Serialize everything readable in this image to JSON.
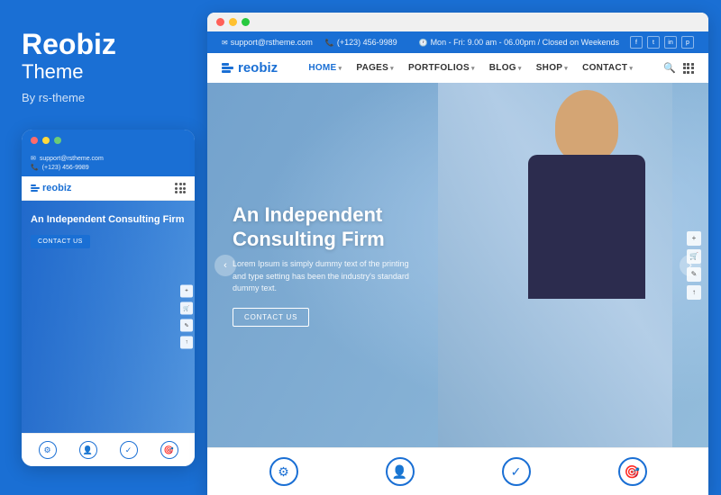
{
  "brand": {
    "name": "Reobiz",
    "subtitle": "Theme",
    "by": "By rs-theme"
  },
  "mobile": {
    "dots": [
      "red",
      "yellow",
      "green"
    ],
    "topbar_items": [
      {
        "icon": "✉",
        "text": "support@rstheme.com"
      },
      {
        "icon": "📞",
        "text": "(+123) 456-9989"
      }
    ],
    "logo_text": "reobiz",
    "hero_title": "An Independent Consulting Firm",
    "hero_btn": "CONTACT US",
    "bottom_icons": [
      "⚙",
      "👤",
      "✓",
      "🎯"
    ]
  },
  "desktop": {
    "topbar": {
      "email": "support@rstheme.com",
      "phone": "(+123) 456-9989",
      "hours": "Mon - Fri: 9.00 am - 06.00pm / Closed on Weekends",
      "socials": [
        "f",
        "t",
        "in",
        "p"
      ]
    },
    "nav": {
      "logo": "reobiz",
      "links": [
        {
          "label": "HOME",
          "active": true,
          "has_dropdown": true
        },
        {
          "label": "PAGES",
          "active": false,
          "has_dropdown": true
        },
        {
          "label": "PORTFOLIOS",
          "active": false,
          "has_dropdown": true
        },
        {
          "label": "BLOG",
          "active": false,
          "has_dropdown": true
        },
        {
          "label": "SHOP",
          "active": false,
          "has_dropdown": true
        },
        {
          "label": "CONTACT",
          "active": false,
          "has_dropdown": true
        }
      ]
    },
    "hero": {
      "title": "An Independent Consulting Firm",
      "subtitle": "Lorem Ipsum is simply dummy text of the printing and type setting has been the industry's standard dummy text.",
      "btn_label": "CONTACT US",
      "arrow_left": "‹",
      "arrow_right": "›"
    },
    "bottom_icons": [
      {
        "icon": "⚙"
      },
      {
        "icon": "👤"
      },
      {
        "icon": "✓"
      },
      {
        "icon": "🎯"
      }
    ]
  }
}
